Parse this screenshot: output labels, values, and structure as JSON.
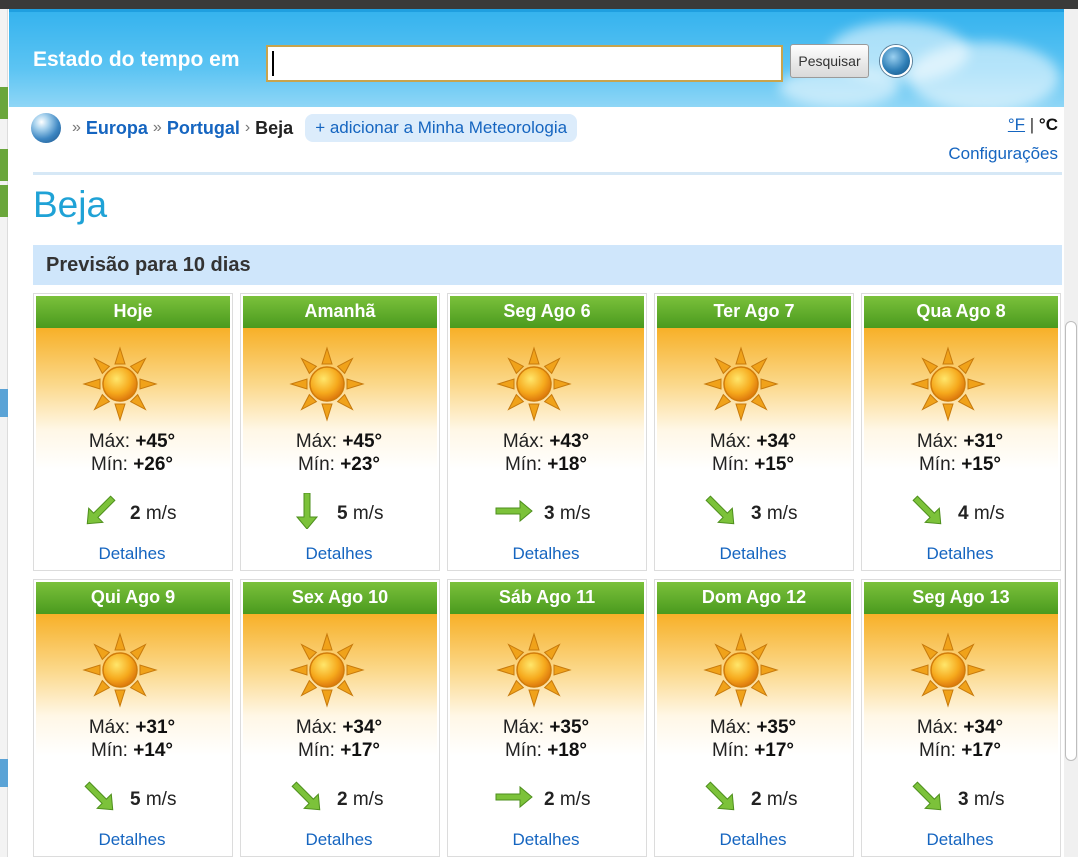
{
  "header": {
    "label": "Estado do tempo em",
    "search_value": "",
    "search_button": "Pesquisar",
    "globe_icon": "globe-icon"
  },
  "breadcrumb": {
    "items": [
      "Europa",
      "Portugal"
    ],
    "current": "Beja",
    "add_label": "+ adicionar a Minha Meteorologia"
  },
  "units": {
    "fahrenheit": "°F",
    "separator": "|",
    "celsius": "°C"
  },
  "settings_label": "Configurações",
  "city": "Beja",
  "forecast_title": "Previsão para 10 dias",
  "labels": {
    "max": "Máx:",
    "min": "Mín:",
    "details": "Detalhes",
    "wind_unit": "m/s"
  },
  "colors": {
    "accent_blue": "#1565c0",
    "city_blue": "#1fa2d6",
    "card_green": "#4a9a1e",
    "card_orange": "#f7b028"
  },
  "days": [
    {
      "day": "Hoje",
      "max": "+45°",
      "min": "+26°",
      "wind_speed": "2",
      "wind_dir": "sw-icon"
    },
    {
      "day": "Amanhã",
      "max": "+45°",
      "min": "+23°",
      "wind_speed": "5",
      "wind_dir": "s-icon"
    },
    {
      "day": "Seg Ago 6",
      "max": "+43°",
      "min": "+18°",
      "wind_speed": "3",
      "wind_dir": "e-icon"
    },
    {
      "day": "Ter Ago 7",
      "max": "+34°",
      "min": "+15°",
      "wind_speed": "3",
      "wind_dir": "se-icon"
    },
    {
      "day": "Qua Ago 8",
      "max": "+31°",
      "min": "+15°",
      "wind_speed": "4",
      "wind_dir": "se-icon"
    },
    {
      "day": "Qui Ago 9",
      "max": "+31°",
      "min": "+14°",
      "wind_speed": "5",
      "wind_dir": "se-icon"
    },
    {
      "day": "Sex Ago 10",
      "max": "+34°",
      "min": "+17°",
      "wind_speed": "2",
      "wind_dir": "se-icon"
    },
    {
      "day": "Sáb Ago 11",
      "max": "+35°",
      "min": "+18°",
      "wind_speed": "2",
      "wind_dir": "e-icon"
    },
    {
      "day": "Dom Ago 12",
      "max": "+35°",
      "min": "+17°",
      "wind_speed": "2",
      "wind_dir": "se-icon"
    },
    {
      "day": "Seg Ago 13",
      "max": "+34°",
      "min": "+17°",
      "wind_speed": "3",
      "wind_dir": "se-icon"
    }
  ]
}
